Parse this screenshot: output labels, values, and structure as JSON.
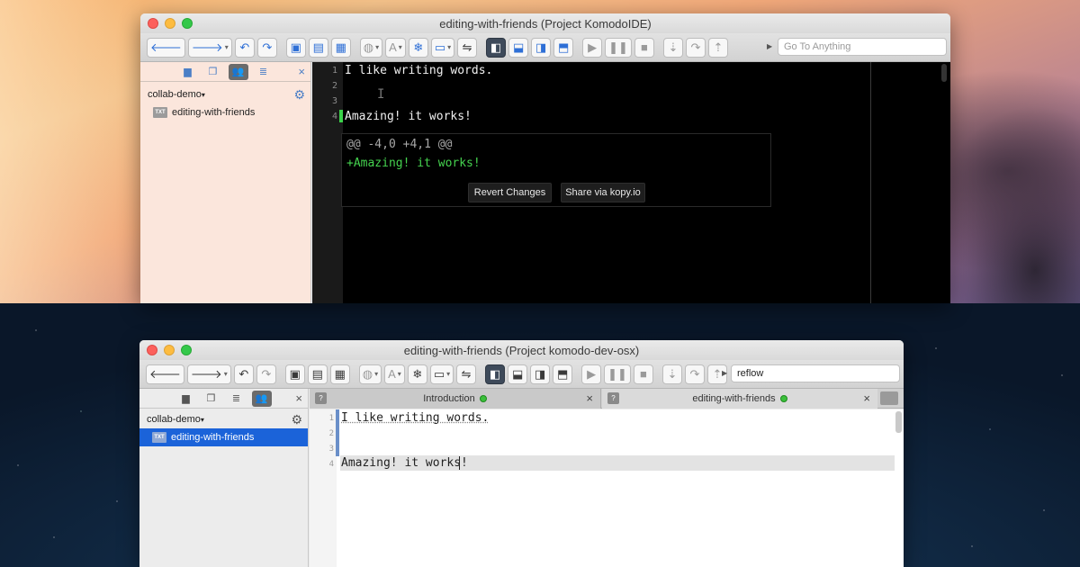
{
  "top_window": {
    "title": "editing-with-friends (Project KomodoIDE)",
    "goto_placeholder": "Go To Anything",
    "sidebar": {
      "project": "collab-demo",
      "project_arrow": "▾",
      "file": "editing-with-friends",
      "file_icon_label": "TXT"
    },
    "editor": {
      "line_numbers": [
        "1",
        "2",
        "3",
        "4"
      ],
      "lines": [
        "I like writing words.",
        "",
        "",
        "Amazing! it works!"
      ],
      "cursor_glyph": "I"
    },
    "diff": {
      "header": "@@ -4,0 +4,1 @@",
      "added": "+Amazing! it works!",
      "revert_label": "Revert Changes",
      "share_label": "Share via kopy.io"
    }
  },
  "bottom_window": {
    "title": "editing-with-friends (Project komodo-dev-osx)",
    "search_value": "reflow",
    "sidebar": {
      "project": "collab-demo",
      "project_arrow": "▾",
      "file": "editing-with-friends",
      "file_icon_label": "TXT"
    },
    "tabs": [
      {
        "label": "Introduction"
      },
      {
        "label": "editing-with-friends"
      }
    ],
    "editor": {
      "line_numbers": [
        "1",
        "2",
        "3",
        "4"
      ],
      "lines": [
        "I like writing words.",
        "",
        "",
        "Amazing! it works!"
      ]
    }
  },
  "toolbar_icons": {
    "back": "🡐",
    "forward": "🡒",
    "undo": "↶",
    "redo": "↷",
    "new_file": "▣",
    "open": "▤",
    "save": "▦",
    "globe": "◍",
    "font": "A",
    "snowflake": "❄",
    "terminal": "▭",
    "sync": "⇋",
    "pane_left": "◧",
    "pane_bottom": "⬓",
    "pane_right": "◨",
    "pane_full": "⬒",
    "play": "▶",
    "pause": "❚❚",
    "stop": "■",
    "step_in": "⇣",
    "step_over": "↷",
    "step_out": "⇡",
    "dropdown": "▾",
    "close": "×",
    "gear": "⚙",
    "folder": "▆",
    "copy": "❐",
    "people": "👥",
    "database": "≣"
  },
  "colors": {
    "accent_blue": "#2e6fd6",
    "selection_blue": "#1b63d9",
    "diff_green": "#3bd34a",
    "sidebar_peach": "#fbe6dc"
  }
}
